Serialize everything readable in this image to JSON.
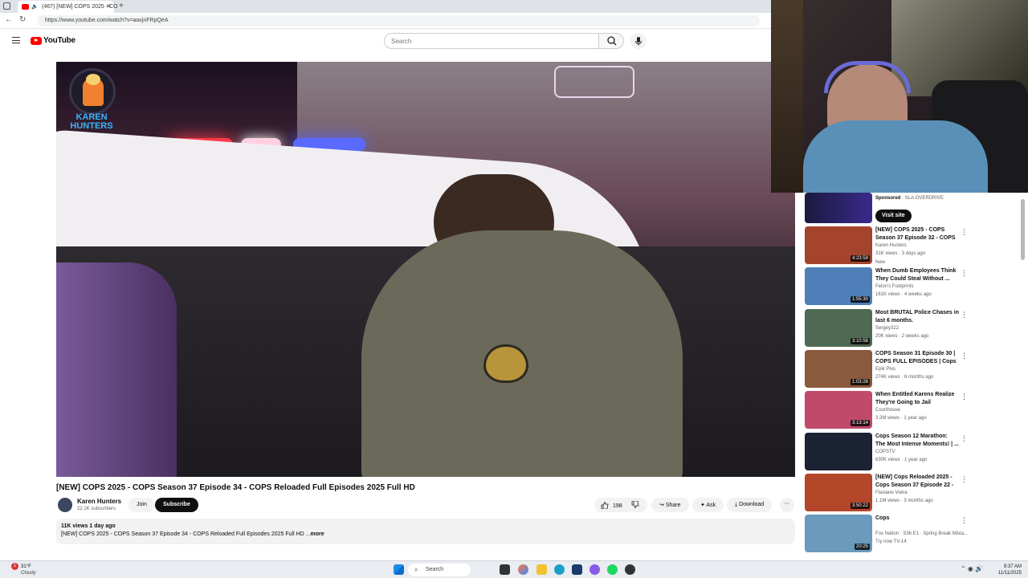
{
  "browser": {
    "tab_title": "(467) [NEW] COPS 2025 - CO",
    "url": "https://www.youtube.com/watch?v=aaxjnFRpQeA",
    "new_tab_symbol": "+"
  },
  "youtube": {
    "logo_text": "YouTube",
    "search_placeholder": "Search"
  },
  "video": {
    "watermark": "KAREN HUNTERS",
    "title": "[NEW] COPS 2025 - COPS Season 37 Episode 34 - COPS Reloaded Full Episodes 2025 Full HD",
    "channel": "Karen Hunters",
    "subscribers": "22.1K subscribers",
    "join_label": "Join",
    "subscribe_label": "Subscribe",
    "likes": "198",
    "share_label": "Share",
    "ask_label": "Ask",
    "download_label": "Download",
    "views_line": "11K views  1 day ago",
    "description": "[NEW] COPS 2025 - COPS Season 37 Episode 34 - COPS Reloaded Full Episodes 2025 Full HD ...",
    "more_label": "more"
  },
  "sidebar": {
    "sponsored": {
      "label": "Sponsored",
      "advertiser": "· SLA.OVERDRIVE",
      "cta": "Visit site"
    },
    "items": [
      {
        "title": "[NEW] COPS 2025 - COPS Season 37 Episode 32 - COPS ...",
        "channel": "Karen Hunters",
        "meta": "31K views · 3 days ago",
        "duration": "4:23:59",
        "tag": "New",
        "thumb": "#a4442c"
      },
      {
        "title": "When Dumb Employees Think They Could Steal Without ...",
        "channel": "Felon's Footprints",
        "meta": "161K views · 4 weeks ago",
        "duration": "1:55:30",
        "thumb": "#4e7fb8"
      },
      {
        "title": "Most BRUTAL Police Chases in last 6 months.",
        "channel": "Sergey322",
        "meta": "20K views · 2 weeks ago",
        "duration": "3:10:58",
        "thumb": "#4f6a52"
      },
      {
        "title": "COPS Season 31 Episode 30 | COPS FULL EPISODES | Cops ...",
        "channel": "Epik Plus",
        "meta": "274K views · 6 months ago",
        "duration": "1:03:26",
        "thumb": "#8a5a3c"
      },
      {
        "title": "When Entitled Karens Realize They're Going to Jail",
        "channel": "Courthouse",
        "meta": "3.2M views · 1 year ago",
        "duration": "3:13:14",
        "thumb": "#c04a6a"
      },
      {
        "title": "Cops Season 12 Marathon: The Most Intense Moments! | ...",
        "channel": "COPSTV",
        "meta": "630K views · 1 year ago",
        "duration": "",
        "thumb": "#1a2233"
      },
      {
        "title": "[NEW] Cops Reloaded 2025 - Cops Season 37 Episode 22 - ...",
        "channel": "Flaviane Vieira",
        "meta": "1.1M views · 3 months ago",
        "duration": "3:50:22",
        "thumb": "#b4462a"
      },
      {
        "title": "Cops",
        "channel": "Fox Nation · S36 E1 · Spring Break Mista...",
        "meta": "Try now  TV-14",
        "duration": "20:25",
        "thumb": "#6a9abc"
      }
    ]
  },
  "taskbar": {
    "weather_temp": "31°F",
    "weather_desc": "Cloudy",
    "search_label": "Search",
    "time": "8:37 AM",
    "date": "11/11/2025",
    "notification_count": "1"
  }
}
